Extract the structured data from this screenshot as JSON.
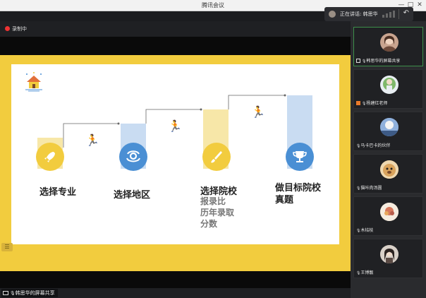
{
  "window": {
    "title": "腾讯会议",
    "minimize": "—",
    "maximize": "□",
    "close": "✕"
  },
  "speaker": {
    "label": "正在讲话:",
    "name": "韩思华"
  },
  "recording": {
    "label": "录制中"
  },
  "share": {
    "label": "韩思华的屏幕共享"
  },
  "slide": {
    "menu_icon": "menu-icon",
    "steps": [
      {
        "title": "选择专业",
        "icon": "rocket-icon",
        "color": "#f2cc3e"
      },
      {
        "title": "选择地区",
        "icon": "location-icon",
        "color": "#4a8fd4"
      },
      {
        "title": "选择院校",
        "subtitle": [
          "报录比",
          "历年录取",
          "分数"
        ],
        "icon": "brush-icon",
        "color": "#f2cc3e"
      },
      {
        "title": "做目标院校",
        "title2": "真题",
        "icon": "trophy-icon",
        "color": "#4a8fd4"
      }
    ]
  },
  "participants": [
    {
      "name": "韩思华的屏幕共享",
      "active": true,
      "avatar_color": "#c9a48f"
    },
    {
      "name": "杨建红老师",
      "active": false,
      "avatar_color": "#7fb86a",
      "badge": "host"
    },
    {
      "name": "马卡巴卡的伙伴",
      "active": false,
      "avatar_color": "#6a8fc4"
    },
    {
      "name": "猫咔肉汤圆",
      "active": false,
      "avatar_color": "#d9a35c"
    },
    {
      "name": "木桔枝",
      "active": false,
      "avatar_color": "#d7785c"
    },
    {
      "name": "王博靓",
      "active": false,
      "avatar_color": "#8c7d74"
    }
  ]
}
